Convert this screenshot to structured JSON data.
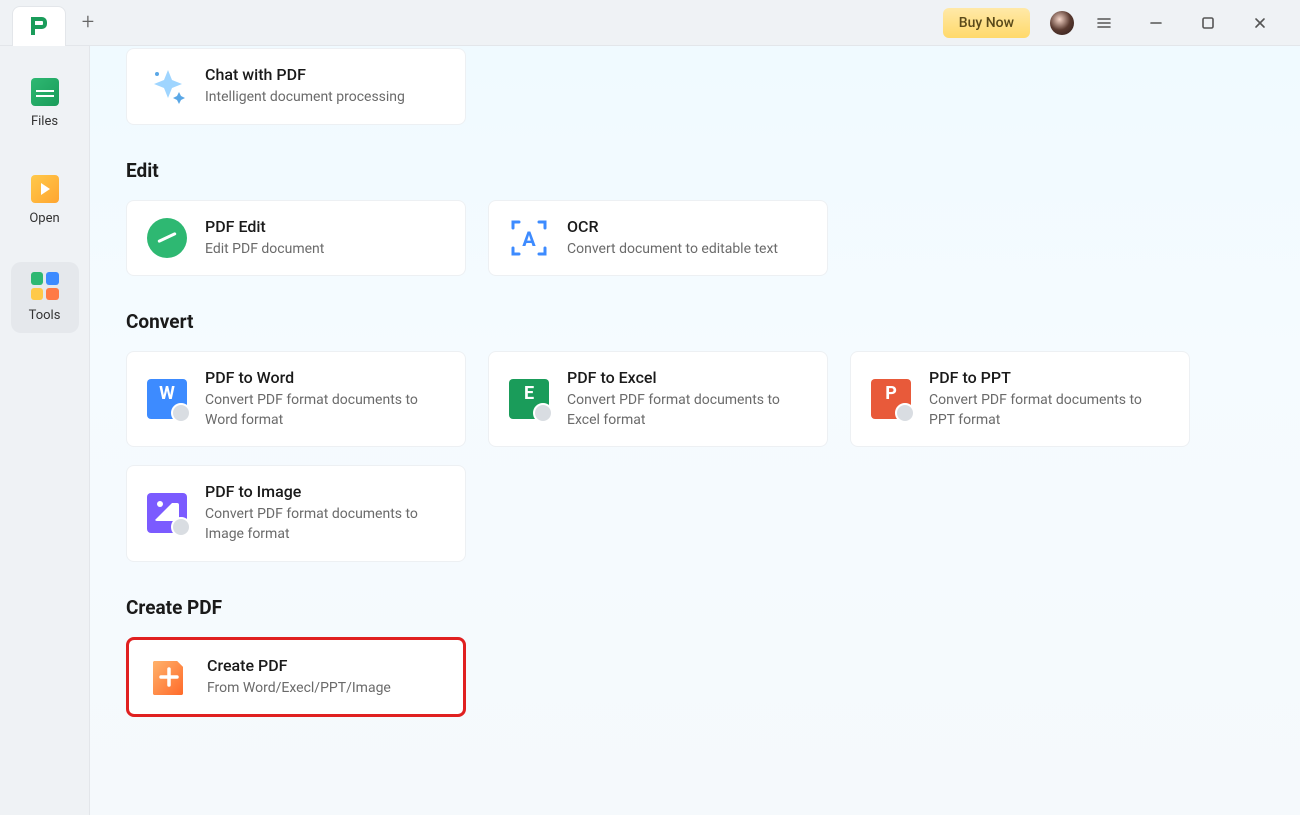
{
  "titlebar": {
    "buy_now_label": "Buy Now"
  },
  "sidebar": {
    "files_label": "Files",
    "open_label": "Open",
    "tools_label": "Tools"
  },
  "chat_card": {
    "title": "Chat with PDF",
    "sub": "Intelligent document processing"
  },
  "sections": {
    "edit_title": "Edit",
    "convert_title": "Convert",
    "create_title": "Create PDF"
  },
  "edit_cards": {
    "pdf_edit": {
      "title": "PDF Edit",
      "sub": "Edit PDF document"
    },
    "ocr": {
      "title": "OCR",
      "sub": "Convert document to editable text"
    }
  },
  "convert_cards": {
    "word": {
      "title": "PDF to Word",
      "sub": "Convert PDF format documents to Word format"
    },
    "excel": {
      "title": "PDF to Excel",
      "sub": "Convert PDF format documents to Excel format"
    },
    "ppt": {
      "title": "PDF to PPT",
      "sub": "Convert PDF format documents to PPT format"
    },
    "image": {
      "title": "PDF to Image",
      "sub": "Convert PDF format documents to Image format"
    }
  },
  "create_cards": {
    "create_pdf": {
      "title": "Create PDF",
      "sub": "From Word/Execl/PPT/Image"
    }
  }
}
